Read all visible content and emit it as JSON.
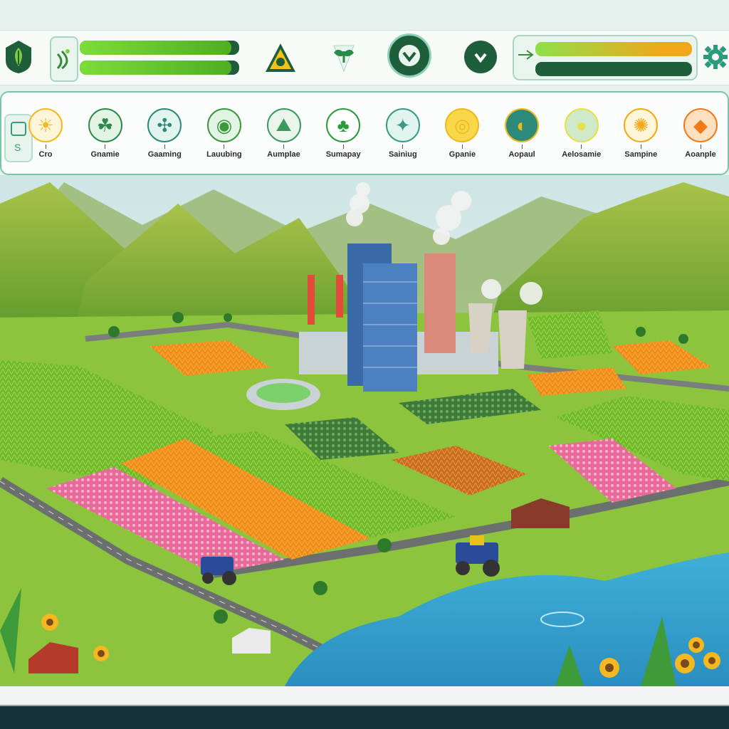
{
  "hud": {
    "left_bar_top_fill": 0.95,
    "left_bar_bottom_fill": 0.95,
    "right_bar_top_fill": 0.82,
    "right_bar_bottom_fill": 0.0,
    "colors": {
      "green": "#5bbd2b",
      "orange": "#f0a818",
      "dark": "#1f5e3a"
    }
  },
  "toolbar": {
    "tools": [
      {
        "label": "Cro",
        "icon": "sun-icon"
      },
      {
        "label": "Gnamie",
        "icon": "leaf-cluster-icon"
      },
      {
        "label": "Gaaming",
        "icon": "windmill-icon"
      },
      {
        "label": "Lauubing",
        "icon": "turtle-icon"
      },
      {
        "label": "Aumplae",
        "icon": "landscape-icon"
      },
      {
        "label": "Sumapay",
        "icon": "clover-icon"
      },
      {
        "label": "Sainiug",
        "icon": "crystal-icon"
      },
      {
        "label": "Gpanie",
        "icon": "gold-coin-icon"
      },
      {
        "label": "Aopaul",
        "icon": "planet-icon"
      },
      {
        "label": "Aelosamie",
        "icon": "lemon-icon"
      },
      {
        "label": "Sampine",
        "icon": "sunflower-icon"
      },
      {
        "label": "Aoanple",
        "icon": "orange-drop-icon"
      }
    ]
  }
}
